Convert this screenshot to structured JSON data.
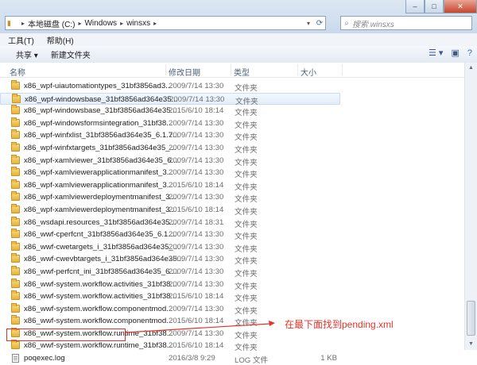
{
  "window": {
    "minimize_glyph": "–",
    "maximize_glyph": "□",
    "close_glyph": "✕"
  },
  "address": {
    "segments": [
      "本地磁盘 (C:)",
      "Windows",
      "winsxs"
    ],
    "separator": "▸"
  },
  "search": {
    "placeholder": "搜索 winsxs"
  },
  "menu": {
    "tools": "工具(T)",
    "help": "帮助(H)"
  },
  "toolbar": {
    "share": "共享 ▾",
    "new_folder": "新建文件夹"
  },
  "columns": {
    "name": "名称",
    "date": "修改日期",
    "type": "类型",
    "size": "大小"
  },
  "files": [
    {
      "name": "x86_wpf-uiautomationtypes_31bf3856ad3...",
      "date": "2009/7/14 13:30",
      "type": "文件夹",
      "size": "",
      "kind": "folder"
    },
    {
      "name": "x86_wpf-windowsbase_31bf3856ad364e35...",
      "date": "2009/7/14 13:30",
      "type": "文件夹",
      "size": "",
      "kind": "folder",
      "selected": true
    },
    {
      "name": "x86_wpf-windowsbase_31bf3856ad364e35...",
      "date": "2015/6/10 18:14",
      "type": "文件夹",
      "size": "",
      "kind": "folder"
    },
    {
      "name": "x86_wpf-windowsformsintegration_31bf38...",
      "date": "2009/7/14 13:30",
      "type": "文件夹",
      "size": "",
      "kind": "folder"
    },
    {
      "name": "x86_wpf-winfxlist_31bf3856ad364e35_6.1.7...",
      "date": "2009/7/14 13:30",
      "type": "文件夹",
      "size": "",
      "kind": "folder"
    },
    {
      "name": "x86_wpf-winfxtargets_31bf3856ad364e35_...",
      "date": "2009/7/14 13:30",
      "type": "文件夹",
      "size": "",
      "kind": "folder"
    },
    {
      "name": "x86_wpf-xamlviewer_31bf3856ad364e35_6....",
      "date": "2009/7/14 13:30",
      "type": "文件夹",
      "size": "",
      "kind": "folder"
    },
    {
      "name": "x86_wpf-xamlviewerapplicationmanifest_3...",
      "date": "2009/7/14 13:30",
      "type": "文件夹",
      "size": "",
      "kind": "folder"
    },
    {
      "name": "x86_wpf-xamlviewerapplicationmanifest_3...",
      "date": "2015/6/10 18:14",
      "type": "文件夹",
      "size": "",
      "kind": "folder"
    },
    {
      "name": "x86_wpf-xamlviewerdeploymentmanifest_3...",
      "date": "2009/7/14 13:30",
      "type": "文件夹",
      "size": "",
      "kind": "folder"
    },
    {
      "name": "x86_wpf-xamlviewerdeploymentmanifest_3...",
      "date": "2015/6/10 18:14",
      "type": "文件夹",
      "size": "",
      "kind": "folder"
    },
    {
      "name": "x86_wsdapi.resources_31bf3856ad364e35...",
      "date": "2009/7/14 18:31",
      "type": "文件夹",
      "size": "",
      "kind": "folder"
    },
    {
      "name": "x86_wwf-cperfcnt_31bf3856ad364e35_6.1....",
      "date": "2009/7/14 13:30",
      "type": "文件夹",
      "size": "",
      "kind": "folder"
    },
    {
      "name": "x86_wwf-cwetargets_i_31bf3856ad364e35_...",
      "date": "2009/7/14 13:30",
      "type": "文件夹",
      "size": "",
      "kind": "folder"
    },
    {
      "name": "x86_wwf-cwevbtargets_i_31bf3856ad364e35...",
      "date": "2009/7/14 13:30",
      "type": "文件夹",
      "size": "",
      "kind": "folder"
    },
    {
      "name": "x86_wwf-perfcnt_ini_31bf3856ad364e35_6....",
      "date": "2009/7/14 13:30",
      "type": "文件夹",
      "size": "",
      "kind": "folder"
    },
    {
      "name": "x86_wwf-system.workflow.activities_31bf38...",
      "date": "2009/7/14 13:30",
      "type": "文件夹",
      "size": "",
      "kind": "folder"
    },
    {
      "name": "x86_wwf-system.workflow.activities_31bf38...",
      "date": "2015/6/10 18:14",
      "type": "文件夹",
      "size": "",
      "kind": "folder"
    },
    {
      "name": "x86_wwf-system.workflow.componentmod...",
      "date": "2009/7/14 13:30",
      "type": "文件夹",
      "size": "",
      "kind": "folder"
    },
    {
      "name": "x86_wwf-system.workflow.componentmod...",
      "date": "2015/6/10 18:14",
      "type": "文件夹",
      "size": "",
      "kind": "folder"
    },
    {
      "name": "x86_wwf-system.workflow.runtime_31bf38...",
      "date": "2009/7/14 13:30",
      "type": "文件夹",
      "size": "",
      "kind": "folder"
    },
    {
      "name": "x86_wwf-system.workflow.runtime_31bf38...",
      "date": "2015/6/10 18:14",
      "type": "文件夹",
      "size": "",
      "kind": "folder"
    },
    {
      "name": "poqexec.log",
      "date": "2016/3/8 9:29",
      "type": "LOG 文件",
      "size": "1 KB",
      "kind": "file"
    }
  ],
  "annotation": {
    "text": "在最下面找到pending.xml",
    "color": "#e5332a"
  },
  "colors": {
    "accent": "#e5332a",
    "selection": "#e2eefa",
    "folder": "#e4b33a"
  }
}
